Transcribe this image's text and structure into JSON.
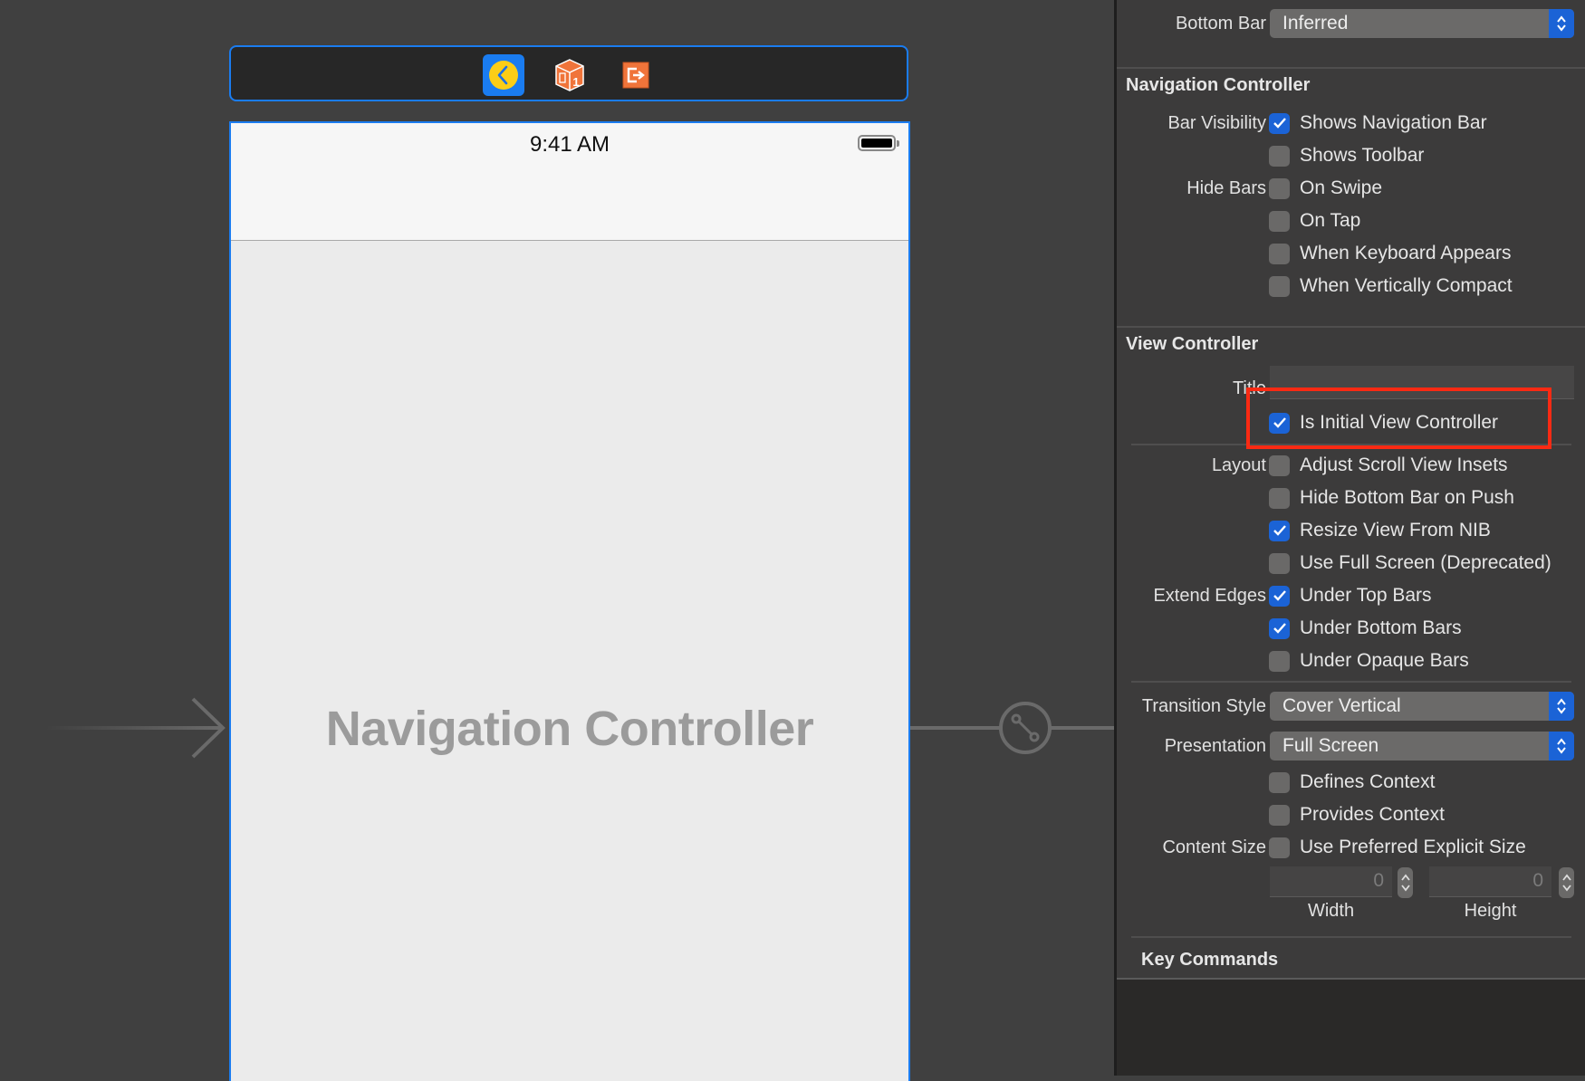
{
  "canvas": {
    "dock": {
      "icons": [
        {
          "name": "view-controller-icon",
          "selected": true
        },
        {
          "name": "first-responder-icon",
          "badge": "1"
        },
        {
          "name": "exit-icon"
        }
      ]
    },
    "phone": {
      "status_time": "9:41 AM",
      "scene_title": "Navigation Controller"
    }
  },
  "inspector": {
    "bottom_bar": {
      "label": "Bottom Bar",
      "value": "Inferred"
    },
    "navigation_controller": {
      "heading": "Navigation Controller",
      "bar_visibility_label": "Bar Visibility",
      "hide_bars_label": "Hide Bars",
      "options": [
        {
          "text": "Shows Navigation Bar",
          "checked": true
        },
        {
          "text": "Shows Toolbar",
          "checked": false
        },
        {
          "text": "On Swipe",
          "checked": false
        },
        {
          "text": "On Tap",
          "checked": false
        },
        {
          "text": "When Keyboard Appears",
          "checked": false
        },
        {
          "text": "When Vertically Compact",
          "checked": false
        }
      ]
    },
    "view_controller": {
      "heading": "View Controller",
      "title_label": "Title",
      "title_value": "",
      "initial": {
        "text": "Is Initial View Controller",
        "checked": true
      },
      "layout_label": "Layout",
      "layout_options": [
        {
          "text": "Adjust Scroll View Insets",
          "checked": false
        },
        {
          "text": "Hide Bottom Bar on Push",
          "checked": false
        },
        {
          "text": "Resize View From NIB",
          "checked": true
        },
        {
          "text": "Use Full Screen (Deprecated)",
          "checked": false
        }
      ],
      "extend_edges_label": "Extend Edges",
      "edge_options": [
        {
          "text": "Under Top Bars",
          "checked": true
        },
        {
          "text": "Under Bottom Bars",
          "checked": true
        },
        {
          "text": "Under Opaque Bars",
          "checked": false
        }
      ],
      "transition_style": {
        "label": "Transition Style",
        "value": "Cover Vertical"
      },
      "presentation": {
        "label": "Presentation",
        "value": "Full Screen"
      },
      "context_options": [
        {
          "text": "Defines Context",
          "checked": false
        },
        {
          "text": "Provides Context",
          "checked": false
        }
      ],
      "content_size_label": "Content Size",
      "content_size_option": {
        "text": "Use Preferred Explicit Size",
        "checked": false
      },
      "width": {
        "value": "0",
        "label": "Width"
      },
      "height": {
        "value": "0",
        "label": "Height"
      }
    },
    "key_commands": {
      "heading": "Key Commands"
    }
  },
  "colors": {
    "accent": "#1b63d6",
    "selection_border": "#1a7cf0",
    "highlight_box": "#fb2a13",
    "object_orange": "#f0743a"
  }
}
